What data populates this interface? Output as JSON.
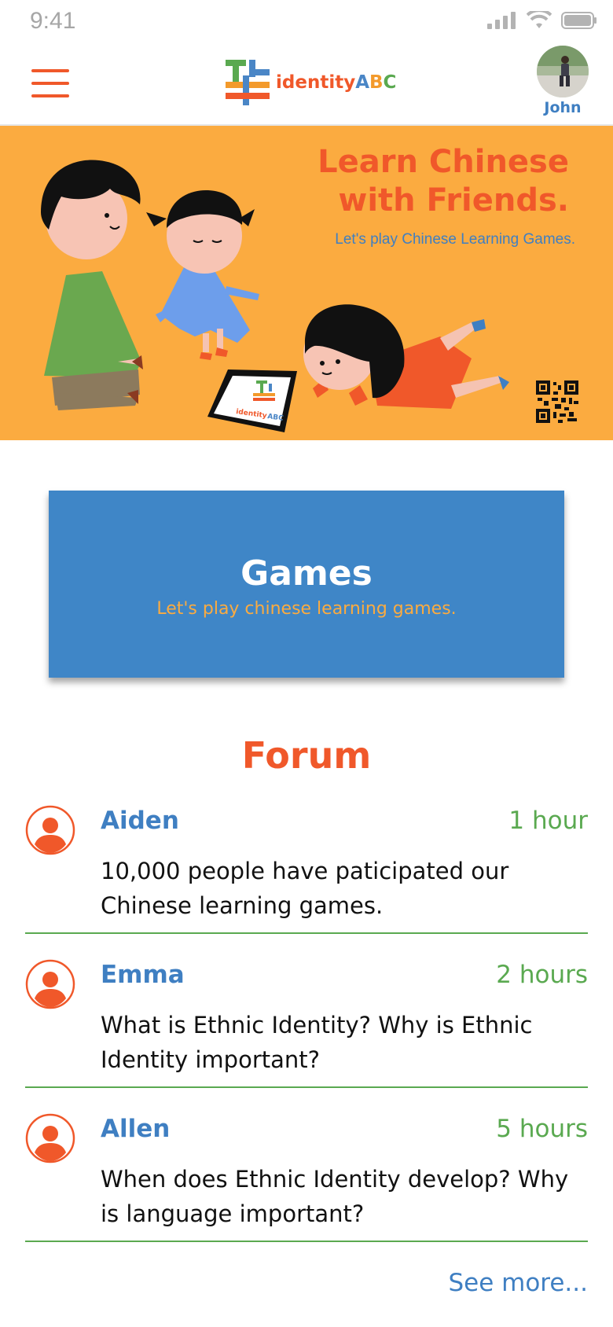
{
  "status_bar": {
    "time": "9:41"
  },
  "header": {
    "logo_prefix": "identity",
    "logo_a": "A",
    "logo_b": "B",
    "logo_c": "C",
    "user_name": "John",
    "icons": {
      "menu": "hamburger-menu-icon",
      "avatar": "user-avatar-photo"
    }
  },
  "hero": {
    "title_line1": "Learn Chinese",
    "title_line2": "with Friends.",
    "subtitle": "Let's play Chinese Learning Games.",
    "tablet_logo_prefix": "identity",
    "tablet_logo_abc": "ABC"
  },
  "games": {
    "title": "Games",
    "subtitle": "Let's play chinese learning games."
  },
  "forum": {
    "title": "Forum",
    "posts": [
      {
        "author": "Aiden",
        "time": "1 hour",
        "body": "10,000 people have paticipated our Chinese learning games."
      },
      {
        "author": "Emma",
        "time": "2 hours",
        "body": "What is Ethnic Identity?  Why is Ethnic Identity important?"
      },
      {
        "author": "Allen",
        "time": "5 hours",
        "body": "When does Ethnic Identity develop? Why is language important?"
      }
    ],
    "see_more": "See more..."
  },
  "colors": {
    "brand_orange": "#f0582a",
    "brand_blue": "#3f86c7",
    "banner_yellow": "#fbab40",
    "accent_green": "#5aa950"
  }
}
